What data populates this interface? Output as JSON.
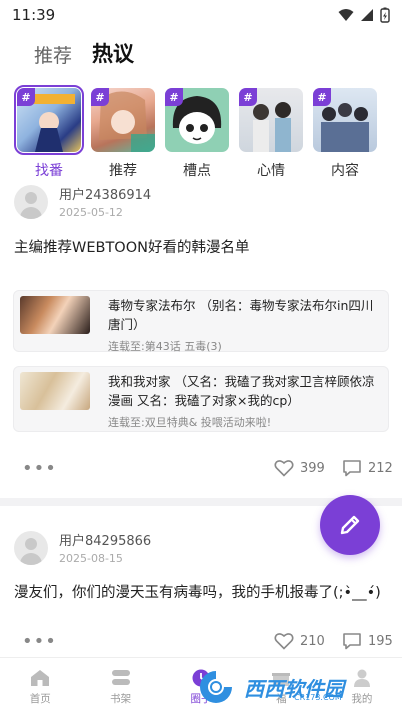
{
  "status_bar": {
    "time": "11:39"
  },
  "top_tabs": [
    {
      "label": "推荐",
      "active": false
    },
    {
      "label": "热议",
      "active": true
    }
  ],
  "categories": [
    {
      "label": "找番",
      "active": true
    },
    {
      "label": "推荐",
      "active": false
    },
    {
      "label": "槽点",
      "active": false
    },
    {
      "label": "心情",
      "active": false
    },
    {
      "label": "内容",
      "active": false
    }
  ],
  "category_hash": "#",
  "posts": [
    {
      "user": "用户24386914",
      "date": "2025-05-12",
      "text": "主编推荐WEBTOON好看的韩漫名单",
      "comics": [
        {
          "title": "毒物专家法布尔 （别名：毒物专家法布尔in四川唐门）",
          "sub": "连载至:第43话 五毒(3)"
        },
        {
          "title": "我和我对家 （又名：我磕了我对家卫言梓顾依凉漫画 又名：我磕了对家×我的cp）",
          "sub": "连载至:双旦特典& 投喂活动来啦!"
        }
      ],
      "likes": "399",
      "comments": "212"
    },
    {
      "user": "用户84295866",
      "date": "2025-08-15",
      "text": "漫友们，你们的漫天玉有病毒吗，我的手机报毒了(;•̀__•́)",
      "likes": "210",
      "comments": "195"
    }
  ],
  "more_label": "•••",
  "bottom_nav": [
    {
      "label": "首页",
      "icon": "home-icon",
      "active": false
    },
    {
      "label": "书架",
      "icon": "bookshelf-icon",
      "active": false
    },
    {
      "label": "圈子",
      "icon": "circle-icon",
      "active": true
    },
    {
      "label": "福",
      "icon": "gift-icon",
      "active": false
    },
    {
      "label": "我的",
      "icon": "user-icon",
      "active": false
    }
  ],
  "watermark": {
    "text": "西西软件园",
    "domain": "CR173.COM"
  },
  "colors": {
    "accent": "#7b3fd6",
    "teal": "#31d1c2"
  }
}
